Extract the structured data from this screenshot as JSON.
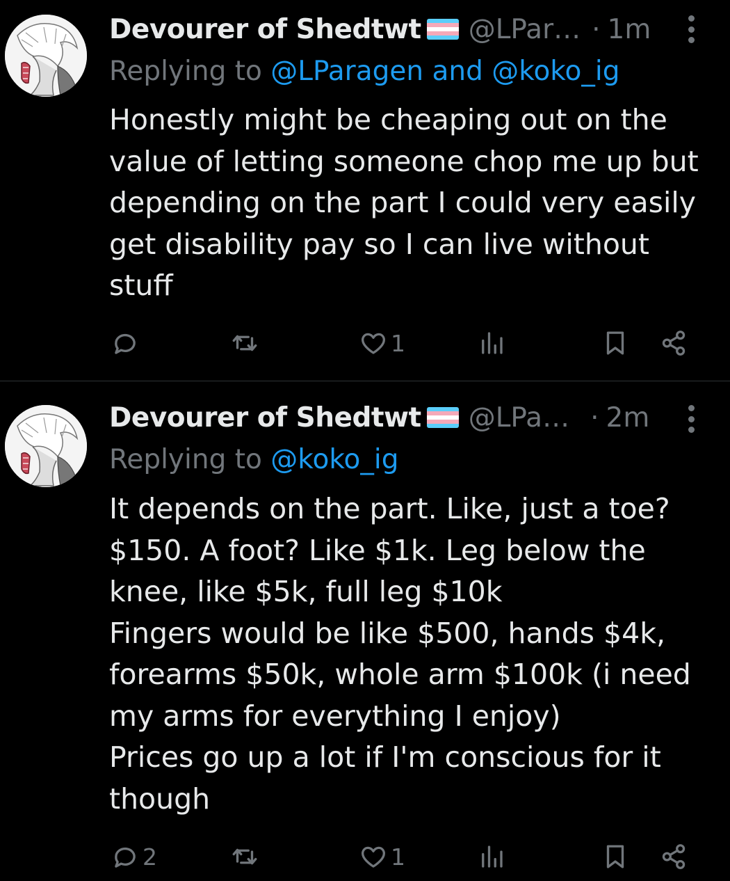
{
  "tweets": [
    {
      "author_name": "Devourer of Shedtwt",
      "handle": "@LPar…",
      "time": "1m",
      "replying_prefix": "Replying to ",
      "mention_1": "@LParagen",
      "mention_and": " and ",
      "mention_2": "@koko_ig",
      "text": "Honestly might be cheaping out on the\nvalue of letting someone chop me up but\ndepending on the part I could very easily\nget disability pay so I can live without\nstuff",
      "reply_count": "",
      "retweet_count": "",
      "like_count": "1",
      "icons": [
        "reply-icon",
        "retweet-icon",
        "like-icon",
        "views-icon",
        "bookmark-icon",
        "share-icon"
      ]
    },
    {
      "author_name": "Devourer of Shedtwt",
      "handle": "@LPa…",
      "time": "2m",
      "replying_prefix": "Replying to ",
      "mention_1": "@koko_ig",
      "text": "It depends on the part. Like, just a toe?\n$150. A foot? Like $1k. Leg below the\nknee, like $5k, full leg $10k\nFingers would be like $500, hands $4k,\nforearms $50k, whole arm $100k (i need\nmy arms for everything I enjoy)\nPrices go up a lot if I'm conscious for it\nthough",
      "reply_count": "2",
      "retweet_count": "",
      "like_count": "1",
      "icons": [
        "reply-icon",
        "retweet-icon",
        "like-icon",
        "views-icon",
        "bookmark-icon",
        "share-icon"
      ]
    }
  ],
  "colors": {
    "background": "#000000",
    "text": "#e7e9ea",
    "secondary": "#71767b",
    "link": "#1d9bf0",
    "divider": "#2f3336",
    "flag_blue": "#5bcefa",
    "flag_pink": "#f5a9b8",
    "flag_white": "#ffffff"
  }
}
